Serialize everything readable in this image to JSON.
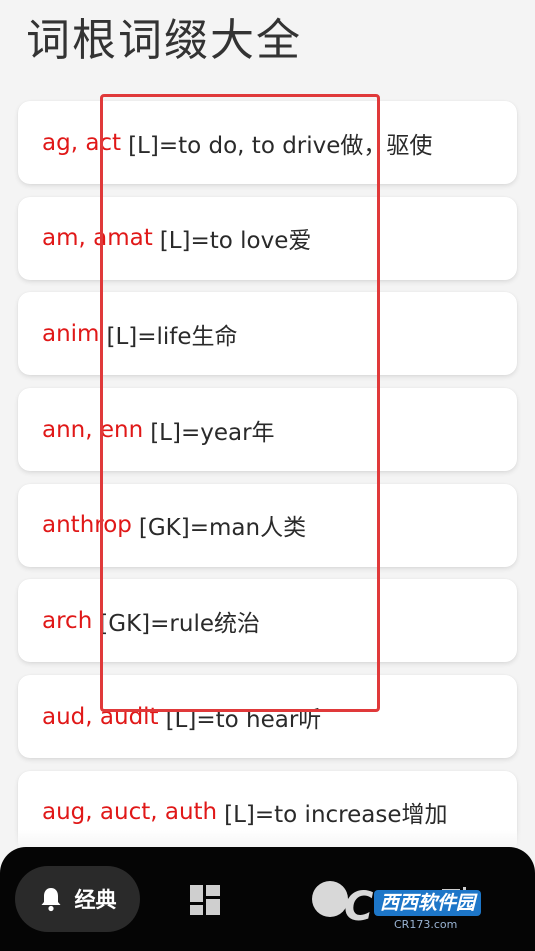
{
  "header": {
    "title": "词根词缀大全"
  },
  "entries": [
    {
      "root": "ag, act",
      "gloss": "[L]=to do, to drive做，驱使"
    },
    {
      "root": "am, amat",
      "gloss": "[L]=to love爱"
    },
    {
      "root": "anim",
      "gloss": "[L]=life生命"
    },
    {
      "root": "ann, enn",
      "gloss": "[L]=year年"
    },
    {
      "root": "anthrop",
      "gloss": "[GK]=man人类"
    },
    {
      "root": "arch",
      "gloss": "[GK]=rule统治"
    },
    {
      "root": "aud, audit",
      "gloss": "[L]=to hear听"
    },
    {
      "root": "aug, auct, auth",
      "gloss": "[L]=to increase增加"
    }
  ],
  "nav": {
    "items": [
      {
        "label": "经典",
        "icon": "bell-icon",
        "active": true
      },
      {
        "label": "",
        "icon": "grid-icon",
        "active": false
      },
      {
        "label": "",
        "icon": "circle-icon",
        "active": false
      },
      {
        "label": "",
        "icon": "list-icon",
        "active": false
      }
    ]
  },
  "watermark": {
    "brand": "西西软件园",
    "site": "CR173.com"
  },
  "colors": {
    "root_text": "#e01818",
    "highlight_border": "#e0393a",
    "nav_bg": "#050505"
  }
}
